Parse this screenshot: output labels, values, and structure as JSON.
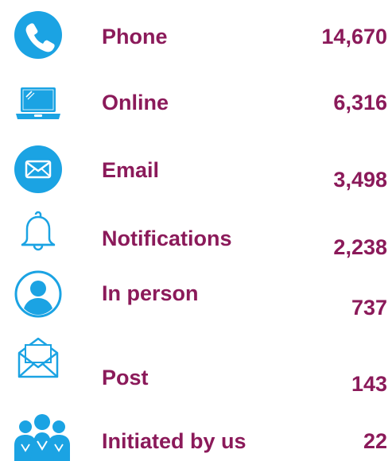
{
  "colors": {
    "text": "#8b1a5a",
    "icon": "#1ba3e3"
  },
  "channels": [
    {
      "icon": "phone-icon",
      "label": "Phone",
      "value": "14,670"
    },
    {
      "icon": "laptop-icon",
      "label": "Online",
      "value": "6,316"
    },
    {
      "icon": "email-icon",
      "label": "Email",
      "value": "3,498"
    },
    {
      "icon": "bell-icon",
      "label": "Notifications",
      "value": "2,238"
    },
    {
      "icon": "person-icon",
      "label": "In person",
      "value": "737"
    },
    {
      "icon": "envelope-open-icon",
      "label": "Post",
      "value": "143"
    },
    {
      "icon": "people-group-icon",
      "label": "Initiated by us",
      "value": "22"
    }
  ]
}
